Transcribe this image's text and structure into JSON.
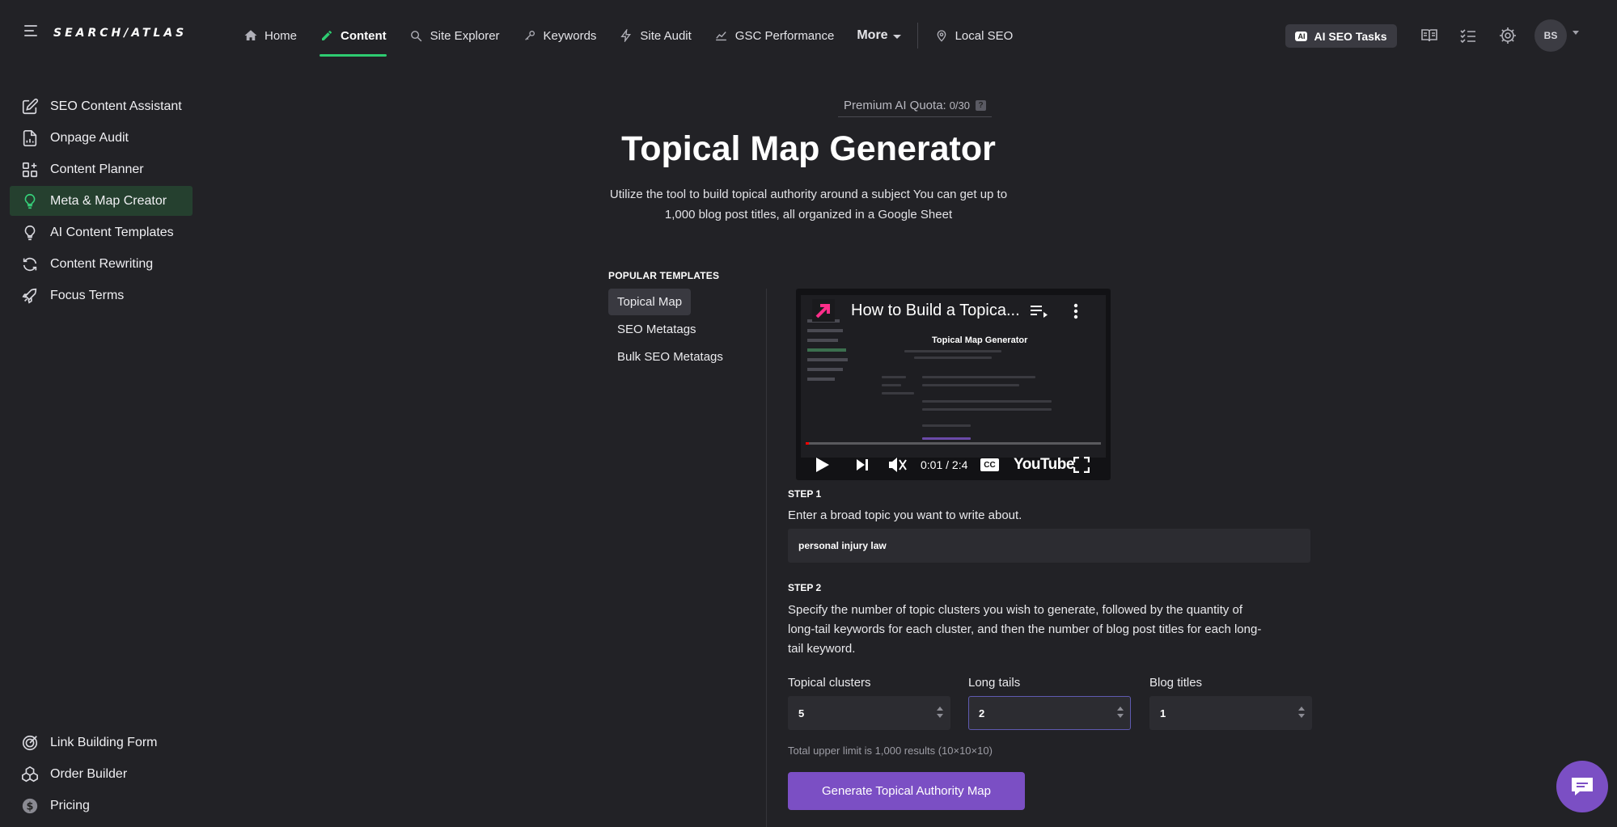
{
  "app": {
    "logo_text": "SEARCH/ATLAS"
  },
  "nav": {
    "items": [
      {
        "label": "Home",
        "icon": "home-icon"
      },
      {
        "label": "Content",
        "icon": "pencil-icon",
        "active": true
      },
      {
        "label": "Site Explorer",
        "icon": "globe-search-icon"
      },
      {
        "label": "Keywords",
        "icon": "key-icon"
      },
      {
        "label": "Site Audit",
        "icon": "bolt-icon"
      },
      {
        "label": "GSC Performance",
        "icon": "trend-icon"
      }
    ],
    "more_label": "More",
    "local_seo_label": "Local SEO",
    "ai_tasks_label": "AI SEO Tasks",
    "ai_badge": "AI",
    "avatar_initials": "BS",
    "accent": "#2ecc71"
  },
  "sidebar": {
    "items": [
      {
        "label": "SEO Content Assistant",
        "icon": "edit-square-icon"
      },
      {
        "label": "Onpage Audit",
        "icon": "document-chart-icon"
      },
      {
        "label": "Content Planner",
        "icon": "grid-plus-icon"
      },
      {
        "label": "Meta & Map Creator",
        "icon": "lightbulb-icon",
        "active": true
      },
      {
        "label": "AI Content Templates",
        "icon": "lightbulb-outline-icon"
      },
      {
        "label": "Content Rewriting",
        "icon": "refresh-icon"
      },
      {
        "label": "Focus Terms",
        "icon": "rocket-icon"
      }
    ],
    "bottom_items": [
      {
        "label": "Link Building Form",
        "icon": "link-target-icon"
      },
      {
        "label": "Order Builder",
        "icon": "cubes-icon"
      },
      {
        "label": "Pricing",
        "icon": "dollar-icon"
      }
    ]
  },
  "main": {
    "quota_label": "Premium AI Quota:",
    "quota_value": "0/30",
    "quota_help": "?",
    "title": "Topical Map Generator",
    "subtitle_line1": "Utilize the tool to build topical authority around a subject You can get up to",
    "subtitle_line2": "1,000 blog post titles, all organized in a Google Sheet",
    "templates_heading": "POPULAR TEMPLATES",
    "templates": [
      "Topical Map",
      "SEO Metatags",
      "Bulk SEO Metatags"
    ],
    "video": {
      "title": "How to Build a Topica...",
      "inner_title": "Topical Map Generator",
      "time": "0:01 / 2:4",
      "brand": "YouTube",
      "cc": "CC"
    },
    "step1": {
      "label": "STEP 1",
      "text": "Enter a broad topic you want to write about.",
      "value": "personal injury law"
    },
    "step2": {
      "label": "STEP 2",
      "text_line1": "Specify the number of topic clusters you wish to generate, followed by the quantity of",
      "text_line2": "long-tail keywords for each cluster, and then the number of blog post titles for each long-",
      "text_line3": "tail keyword."
    },
    "fields": [
      {
        "label": "Topical clusters",
        "value": "5"
      },
      {
        "label": "Long tails",
        "value": "2"
      },
      {
        "label": "Blog titles",
        "value": "1"
      }
    ],
    "limit_note": "Total upper limit is 1,000 results (10×10×10)",
    "generate_label": "Generate Topical Authority Map",
    "button_color": "#7b4fc4"
  }
}
